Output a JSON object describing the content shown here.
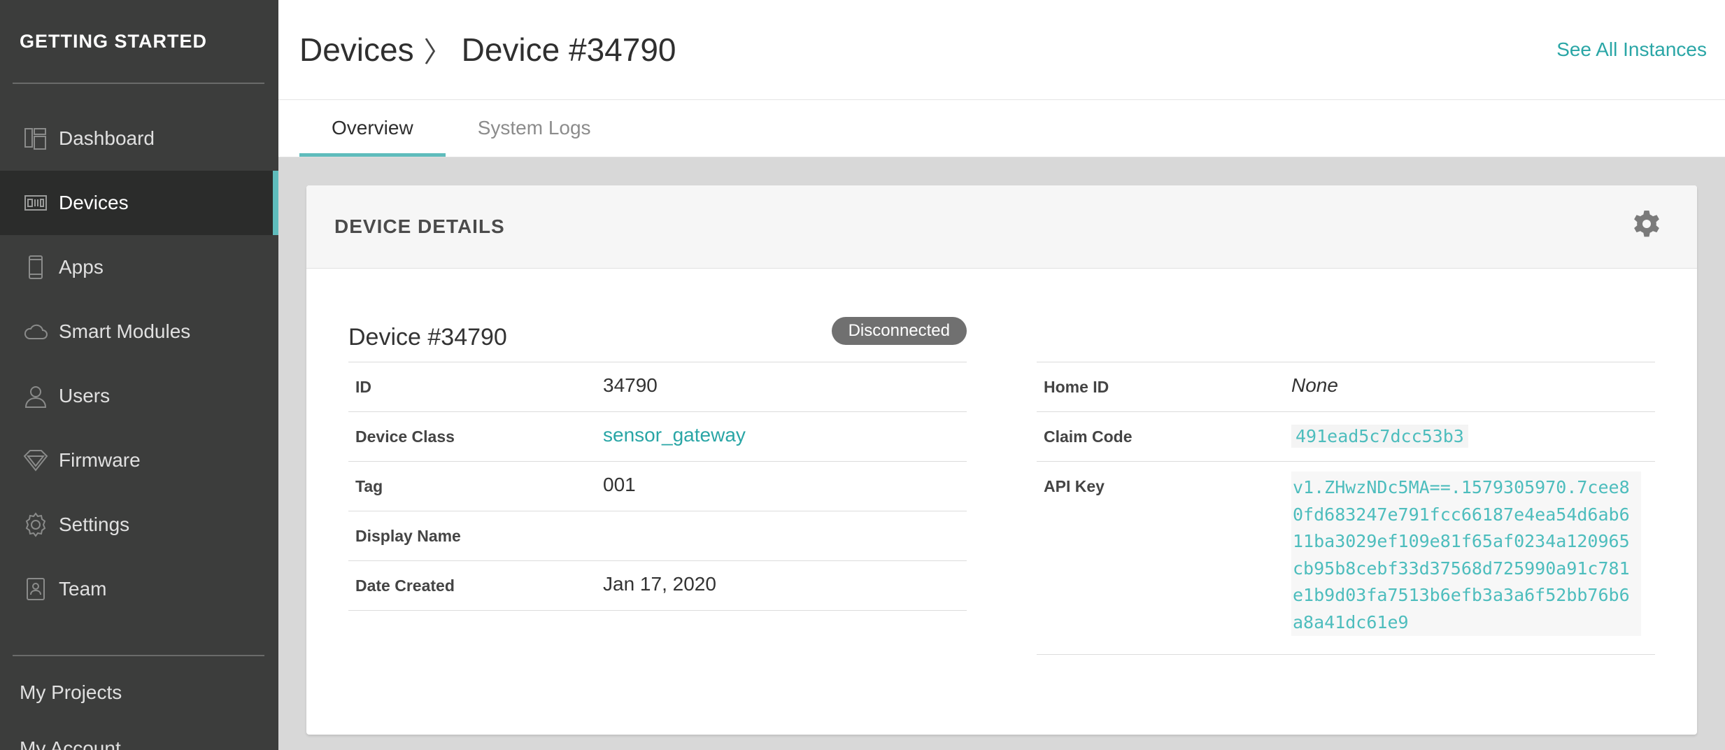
{
  "sidebar": {
    "title": "GETTING STARTED",
    "items": [
      {
        "label": "Dashboard",
        "icon": "dashboard-icon",
        "active": false
      },
      {
        "label": "Devices",
        "icon": "devices-icon",
        "active": true
      },
      {
        "label": "Apps",
        "icon": "phone-icon",
        "active": false
      },
      {
        "label": "Smart Modules",
        "icon": "cloud-icon",
        "active": false
      },
      {
        "label": "Users",
        "icon": "user-icon",
        "active": false
      },
      {
        "label": "Firmware",
        "icon": "diamond-icon",
        "active": false
      },
      {
        "label": "Settings",
        "icon": "gear-icon",
        "active": false
      },
      {
        "label": "Team",
        "icon": "badge-icon",
        "active": false
      }
    ],
    "bottom": [
      {
        "label": "My Projects"
      },
      {
        "label": "My Account"
      }
    ]
  },
  "header": {
    "crumb_root": "Devices",
    "crumb_sep": "〉",
    "crumb_current": "Device #34790",
    "see_all": "See All Instances"
  },
  "tabs": [
    {
      "label": "Overview",
      "active": true
    },
    {
      "label": "System Logs",
      "active": false
    }
  ],
  "card": {
    "title": "DEVICE DETAILS",
    "device_name": "Device #34790",
    "status": "Disconnected",
    "left_rows": [
      {
        "label": "ID",
        "value": "34790"
      },
      {
        "label": "Device Class",
        "value": "sensor_gateway"
      },
      {
        "label": "Tag",
        "value": "001"
      },
      {
        "label": "Display Name",
        "value": ""
      },
      {
        "label": "Date Created",
        "value": "Jan 17, 2020"
      }
    ],
    "right_rows": [
      {
        "label": "Home ID",
        "value": "None"
      },
      {
        "label": "Claim Code",
        "value": "491ead5c7dcc53b3"
      },
      {
        "label": "API Key",
        "value": "v1.ZHwzNDc5MA==.1579305970.7cee80fd683247e791fcc66187e4ea54d6ab611ba3029ef109e81f65af0234a120965cb95b8cebf33d37568d725990a91c781e1b9d03fa7513b6efb3a3a6f52bb76b6a8a41dc61e9"
      }
    ]
  },
  "colors": {
    "accent": "#5fbcbc",
    "link": "#2aa6a6",
    "sidebar_bg": "#3c3d3c",
    "badge_bg": "#707070"
  }
}
